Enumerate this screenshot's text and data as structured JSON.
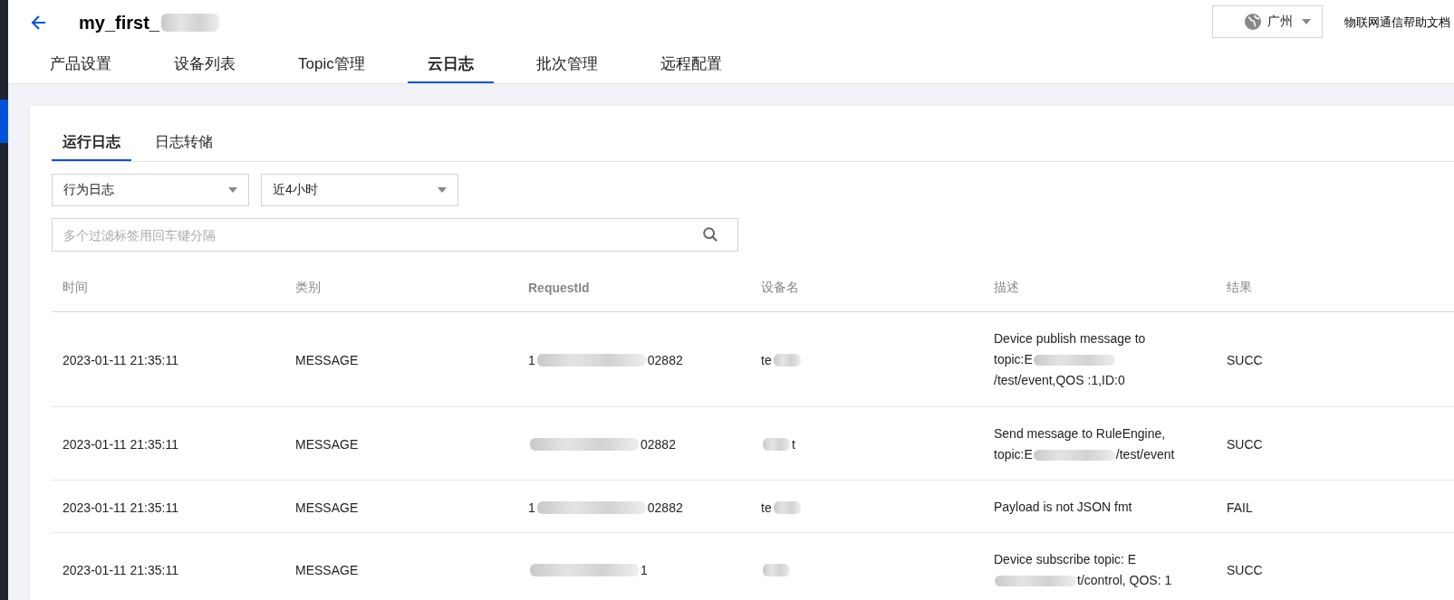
{
  "header": {
    "title": "my_first_",
    "title_redacted": true,
    "region": "广州",
    "help_link": "物联网通信帮助文档"
  },
  "nav_tabs": [
    {
      "label": "产品设置",
      "selected": false
    },
    {
      "label": "设备列表",
      "selected": false
    },
    {
      "label": "Topic管理",
      "selected": false
    },
    {
      "label": "云日志",
      "selected": true
    },
    {
      "label": "批次管理",
      "selected": false
    },
    {
      "label": "远程配置",
      "selected": false
    }
  ],
  "log_tabs": [
    {
      "label": "运行日志",
      "selected": true
    },
    {
      "label": "日志转储",
      "selected": false
    }
  ],
  "filters": {
    "log_type": "行为日志",
    "time_range": "近4小时",
    "search": {
      "placeholder": "多个过滤标签用回车键分隔"
    }
  },
  "table": {
    "columns": [
      "时间",
      "类别",
      "RequestId",
      "设备名",
      "描述",
      "结果"
    ],
    "rows": [
      {
        "time": "2023-01-11 21:35:11",
        "category": "MESSAGE",
        "request_id": {
          "before": "1",
          "after": "02882"
        },
        "device": {
          "before": "te"
        },
        "description": {
          "before": "Device publish message to topic:E",
          "after": "/test/event,QOS :1,ID:0"
        },
        "result": "SUCC"
      },
      {
        "time": "2023-01-11 21:35:11",
        "category": "MESSAGE",
        "request_id": {
          "after": "02882"
        },
        "device": {
          "after": "t"
        },
        "description": {
          "before": "Send message to RuleEngine, topic:E",
          "after": "/test/event"
        },
        "result": "SUCC"
      },
      {
        "time": "2023-01-11 21:35:11",
        "category": "MESSAGE",
        "request_id": {
          "before": "1",
          "after": "02882"
        },
        "device": {
          "before": "te"
        },
        "description": {
          "before": "Payload is not JSON fmt"
        },
        "result": "FAIL"
      },
      {
        "time": "2023-01-11 21:35:11",
        "category": "MESSAGE",
        "request_id": {
          "after": "1"
        },
        "device": {},
        "description": {
          "before": "Device subscribe topic: E",
          "after": "t/control, QOS: 1"
        },
        "result": "SUCC"
      }
    ]
  }
}
